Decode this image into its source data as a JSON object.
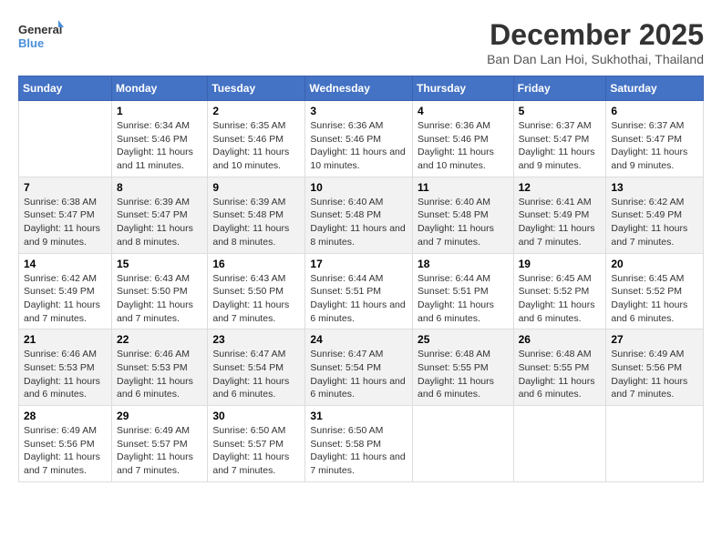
{
  "logo": {
    "line1": "General",
    "line2": "Blue"
  },
  "title": "December 2025",
  "location": "Ban Dan Lan Hoi, Sukhothai, Thailand",
  "days_header": [
    "Sunday",
    "Monday",
    "Tuesday",
    "Wednesday",
    "Thursday",
    "Friday",
    "Saturday"
  ],
  "weeks": [
    [
      {
        "day": "",
        "sunrise": "",
        "sunset": "",
        "daylight": ""
      },
      {
        "day": "1",
        "sunrise": "Sunrise: 6:34 AM",
        "sunset": "Sunset: 5:46 PM",
        "daylight": "Daylight: 11 hours and 11 minutes."
      },
      {
        "day": "2",
        "sunrise": "Sunrise: 6:35 AM",
        "sunset": "Sunset: 5:46 PM",
        "daylight": "Daylight: 11 hours and 10 minutes."
      },
      {
        "day": "3",
        "sunrise": "Sunrise: 6:36 AM",
        "sunset": "Sunset: 5:46 PM",
        "daylight": "Daylight: 11 hours and 10 minutes."
      },
      {
        "day": "4",
        "sunrise": "Sunrise: 6:36 AM",
        "sunset": "Sunset: 5:46 PM",
        "daylight": "Daylight: 11 hours and 10 minutes."
      },
      {
        "day": "5",
        "sunrise": "Sunrise: 6:37 AM",
        "sunset": "Sunset: 5:47 PM",
        "daylight": "Daylight: 11 hours and 9 minutes."
      },
      {
        "day": "6",
        "sunrise": "Sunrise: 6:37 AM",
        "sunset": "Sunset: 5:47 PM",
        "daylight": "Daylight: 11 hours and 9 minutes."
      }
    ],
    [
      {
        "day": "7",
        "sunrise": "Sunrise: 6:38 AM",
        "sunset": "Sunset: 5:47 PM",
        "daylight": "Daylight: 11 hours and 9 minutes."
      },
      {
        "day": "8",
        "sunrise": "Sunrise: 6:39 AM",
        "sunset": "Sunset: 5:47 PM",
        "daylight": "Daylight: 11 hours and 8 minutes."
      },
      {
        "day": "9",
        "sunrise": "Sunrise: 6:39 AM",
        "sunset": "Sunset: 5:48 PM",
        "daylight": "Daylight: 11 hours and 8 minutes."
      },
      {
        "day": "10",
        "sunrise": "Sunrise: 6:40 AM",
        "sunset": "Sunset: 5:48 PM",
        "daylight": "Daylight: 11 hours and 8 minutes."
      },
      {
        "day": "11",
        "sunrise": "Sunrise: 6:40 AM",
        "sunset": "Sunset: 5:48 PM",
        "daylight": "Daylight: 11 hours and 7 minutes."
      },
      {
        "day": "12",
        "sunrise": "Sunrise: 6:41 AM",
        "sunset": "Sunset: 5:49 PM",
        "daylight": "Daylight: 11 hours and 7 minutes."
      },
      {
        "day": "13",
        "sunrise": "Sunrise: 6:42 AM",
        "sunset": "Sunset: 5:49 PM",
        "daylight": "Daylight: 11 hours and 7 minutes."
      }
    ],
    [
      {
        "day": "14",
        "sunrise": "Sunrise: 6:42 AM",
        "sunset": "Sunset: 5:49 PM",
        "daylight": "Daylight: 11 hours and 7 minutes."
      },
      {
        "day": "15",
        "sunrise": "Sunrise: 6:43 AM",
        "sunset": "Sunset: 5:50 PM",
        "daylight": "Daylight: 11 hours and 7 minutes."
      },
      {
        "day": "16",
        "sunrise": "Sunrise: 6:43 AM",
        "sunset": "Sunset: 5:50 PM",
        "daylight": "Daylight: 11 hours and 7 minutes."
      },
      {
        "day": "17",
        "sunrise": "Sunrise: 6:44 AM",
        "sunset": "Sunset: 5:51 PM",
        "daylight": "Daylight: 11 hours and 6 minutes."
      },
      {
        "day": "18",
        "sunrise": "Sunrise: 6:44 AM",
        "sunset": "Sunset: 5:51 PM",
        "daylight": "Daylight: 11 hours and 6 minutes."
      },
      {
        "day": "19",
        "sunrise": "Sunrise: 6:45 AM",
        "sunset": "Sunset: 5:52 PM",
        "daylight": "Daylight: 11 hours and 6 minutes."
      },
      {
        "day": "20",
        "sunrise": "Sunrise: 6:45 AM",
        "sunset": "Sunset: 5:52 PM",
        "daylight": "Daylight: 11 hours and 6 minutes."
      }
    ],
    [
      {
        "day": "21",
        "sunrise": "Sunrise: 6:46 AM",
        "sunset": "Sunset: 5:53 PM",
        "daylight": "Daylight: 11 hours and 6 minutes."
      },
      {
        "day": "22",
        "sunrise": "Sunrise: 6:46 AM",
        "sunset": "Sunset: 5:53 PM",
        "daylight": "Daylight: 11 hours and 6 minutes."
      },
      {
        "day": "23",
        "sunrise": "Sunrise: 6:47 AM",
        "sunset": "Sunset: 5:54 PM",
        "daylight": "Daylight: 11 hours and 6 minutes."
      },
      {
        "day": "24",
        "sunrise": "Sunrise: 6:47 AM",
        "sunset": "Sunset: 5:54 PM",
        "daylight": "Daylight: 11 hours and 6 minutes."
      },
      {
        "day": "25",
        "sunrise": "Sunrise: 6:48 AM",
        "sunset": "Sunset: 5:55 PM",
        "daylight": "Daylight: 11 hours and 6 minutes."
      },
      {
        "day": "26",
        "sunrise": "Sunrise: 6:48 AM",
        "sunset": "Sunset: 5:55 PM",
        "daylight": "Daylight: 11 hours and 6 minutes."
      },
      {
        "day": "27",
        "sunrise": "Sunrise: 6:49 AM",
        "sunset": "Sunset: 5:56 PM",
        "daylight": "Daylight: 11 hours and 7 minutes."
      }
    ],
    [
      {
        "day": "28",
        "sunrise": "Sunrise: 6:49 AM",
        "sunset": "Sunset: 5:56 PM",
        "daylight": "Daylight: 11 hours and 7 minutes."
      },
      {
        "day": "29",
        "sunrise": "Sunrise: 6:49 AM",
        "sunset": "Sunset: 5:57 PM",
        "daylight": "Daylight: 11 hours and 7 minutes."
      },
      {
        "day": "30",
        "sunrise": "Sunrise: 6:50 AM",
        "sunset": "Sunset: 5:57 PM",
        "daylight": "Daylight: 11 hours and 7 minutes."
      },
      {
        "day": "31",
        "sunrise": "Sunrise: 6:50 AM",
        "sunset": "Sunset: 5:58 PM",
        "daylight": "Daylight: 11 hours and 7 minutes."
      },
      {
        "day": "",
        "sunrise": "",
        "sunset": "",
        "daylight": ""
      },
      {
        "day": "",
        "sunrise": "",
        "sunset": "",
        "daylight": ""
      },
      {
        "day": "",
        "sunrise": "",
        "sunset": "",
        "daylight": ""
      }
    ]
  ]
}
